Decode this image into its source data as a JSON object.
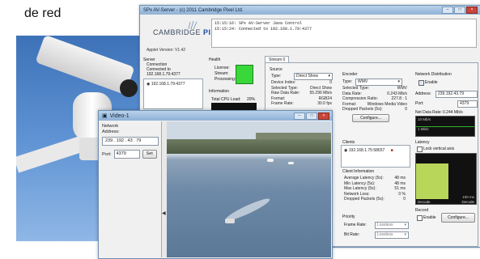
{
  "caption": "de red",
  "main_window": {
    "title": "SPx AV-Server - (c) 2011 Cambridge Pixel Ltd.",
    "logo": {
      "word1": "CAMBRIDGE",
      "word2": "PIXEL"
    },
    "log_lines": [
      "15:15:16: SPx AV-Server Java Control",
      "15:15:24: Connected to 192.168.1.79:4377"
    ],
    "applet_version": "Applet Version:  V1.42",
    "server": {
      "heading": "Server",
      "connection_label": "Connection",
      "connected_text": "Connected to",
      "connected_addr": "192.168.1.79:4377",
      "list_item": "192.168.1.79:4377"
    },
    "health": {
      "heading": "Health",
      "license": "License:",
      "stream": "Stream:",
      "processing": "Processing:",
      "information": "Information",
      "cpu_label": "Total CPU Load:",
      "cpu_value": "20%"
    },
    "stream_tab": "Stream 0",
    "source": {
      "heading": "Source",
      "type_label": "Type:",
      "type_value": "Direct Show",
      "rows": [
        [
          "Device Index:",
          "0"
        ],
        [
          "Selected Type:",
          "Direct Show"
        ],
        [
          "Raw Data Rate:",
          "55.296 Mb/s"
        ],
        [
          "Format:",
          "RGB24"
        ],
        [
          "Frame Rate:",
          "30.0 fps"
        ]
      ]
    },
    "encoder": {
      "heading": "Encoder",
      "type_label": "Type:",
      "type_value": "WMV",
      "rows": [
        [
          "Selected Type:",
          "WMV"
        ],
        [
          "Data Rate:",
          "0.243 Mb/s"
        ],
        [
          "Compression Ratio:",
          "227.8 : 1"
        ],
        [
          "Format:",
          "Windows Media Video"
        ],
        [
          "Dropped Packets (5s):",
          "0"
        ]
      ],
      "configure": "Configure..."
    },
    "network_distribution": {
      "heading": "Network Distribution",
      "enable": "Enable",
      "address_label": "Address:",
      "address_value": "239.192.43.79",
      "port_label": "Port:",
      "port_value": "4379",
      "net_rate_label": "Net Data Rate:",
      "net_rate_value": "0.244 Mb/s",
      "graph_labels": [
        "10 Mb/s",
        "1 Mb/s"
      ]
    },
    "clients": {
      "heading": "Clients",
      "item": "192.168.1.75:58657",
      "info_heading": "Client Information",
      "rows": [
        [
          "Average Latency (5s):",
          "48 ms"
        ],
        [
          "Min Latency (5s):",
          "48 ms"
        ],
        [
          "Max Latency (5s):",
          "51 ms"
        ],
        [
          "Network Loss:",
          "0 %"
        ],
        [
          "Dropped Packets (5s):",
          "0"
        ]
      ]
    },
    "latency": {
      "heading": "Latency",
      "lock": "Lock vertical axis",
      "graph_labels": [
        "100 ms",
        "Decode",
        "Decode"
      ]
    },
    "priority": {
      "heading": "Priority",
      "frame_rate_label": "Frame Rate:",
      "frame_rate_value": "Lossless",
      "bit_rate_label": "Bit Rate:",
      "bit_rate_value": "Lossless"
    },
    "record": {
      "heading": "Record",
      "enable": "Enable",
      "configure": "Configure..."
    }
  },
  "video_window": {
    "title": "Video-1",
    "network_heading": "Network",
    "address_label": "Address:",
    "address_value": "239 . 192 . 43 . 79",
    "port_label": "Port:",
    "port_value": "4379",
    "set_button": "Set",
    "splitter_glyph": "◀"
  }
}
